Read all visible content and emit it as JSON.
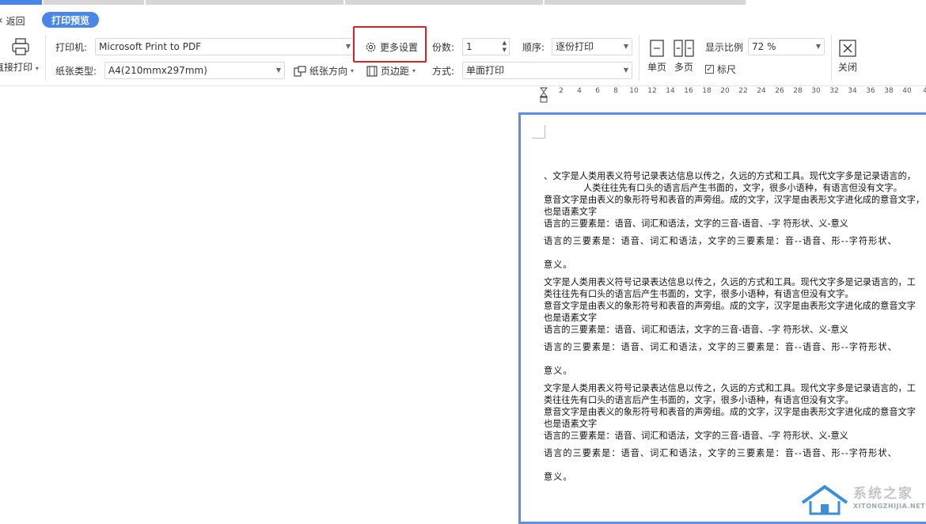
{
  "nav": {
    "back_label": "返回",
    "preview_label": "打印预览"
  },
  "toolbar": {
    "direct_print_label": "直接打印",
    "printer_label": "打印机:",
    "printer_value": "Microsoft Print to PDF",
    "more_settings_label": "更多设置",
    "copies_label": "份数:",
    "copies_value": "1",
    "order_label": "顺序:",
    "order_value": "逐份打印",
    "paper_type_label": "纸张类型:",
    "paper_type_value": "A4(210mmx297mm)",
    "orientation_label": "纸张方向",
    "margin_label": "页边距",
    "mode_label": "方式:",
    "mode_value": "单面打印",
    "single_page_label": "单页",
    "multi_page_label": "多页",
    "zoom_label": "显示比例",
    "zoom_value": "72 %",
    "ruler_label": "标尺",
    "ruler_checked": true,
    "close_label": "关闭"
  },
  "ruler": {
    "ticks": [
      "2",
      "4",
      "6",
      "8",
      "10",
      "12",
      "14",
      "16",
      "18",
      "20",
      "22",
      "24",
      "26",
      "28",
      "30",
      "32",
      "34",
      "36",
      "38",
      "40",
      "4"
    ]
  },
  "document": {
    "lines": [
      "、文字是人类用表义符号记录表达信息以传之，久远的方式和工具。现代文字多是记录语言的，",
      "人类往往先有口头的语言后产生书面的，文字，很多小语种，有语言但没有文字。",
      "意音文字是由表义的象形符号和表音的声旁组。成的文字，汉字是由表形文字进化成的意音文字，",
      "也是语素文字",
      "语言的三要素是：语音、词汇和语法，文字的三音-语音、-字 符形状、义-意义",
      "语言的三要素是：语音、词汇和语法，文字的三要素是：音--语音、形--字符形状、",
      "意义。",
      "文字是人类用表义符号记录表达信息以传之，久远的方式和工具。现代文字多是记录语言的，工",
      "类往往先有口头的语言后产生书面的，文字，很多小语种，有语言但没有文字。",
      "意音文字是由表义的象形符号和表音的声旁组。成的文字，汉字是由表形文字进化成的意音文字",
      "也是语素文字",
      "语言的三要素是：语音、词汇和语法，文字的三音-语音、-字 符形状、义-意义",
      "语言的三要素是：语音、词汇和语法，文字的三要素是：音--语音、形--字符形状、",
      "意义。",
      "文字是人类用表义符号记录表达信息以传之，久远的方式和工具。现代文字多是记录语言的，工",
      "类往往先有口头的语言后产生书面的，文字，很多小语种，有语言但没有文字。",
      "意音文字是由表义的象形符号和表音的声旁组。成的文字，汉字是由表形文字进化成的意音文字",
      "也是语素文字",
      "语言的三要素是：语音、词汇和语法，文字的三音-语音、-字 符形状、义-意义",
      "语言的三要素是：语音、词汇和语法，文字的三要素是：音--语音、形--字符形状、",
      "意义。"
    ]
  },
  "watermark": {
    "cn": "系统之家",
    "en": "XITONGZHIJIA.NET"
  },
  "colors": {
    "accent": "#4a86e8",
    "highlight": "#e02020",
    "page_border": "#5b8fe6"
  }
}
